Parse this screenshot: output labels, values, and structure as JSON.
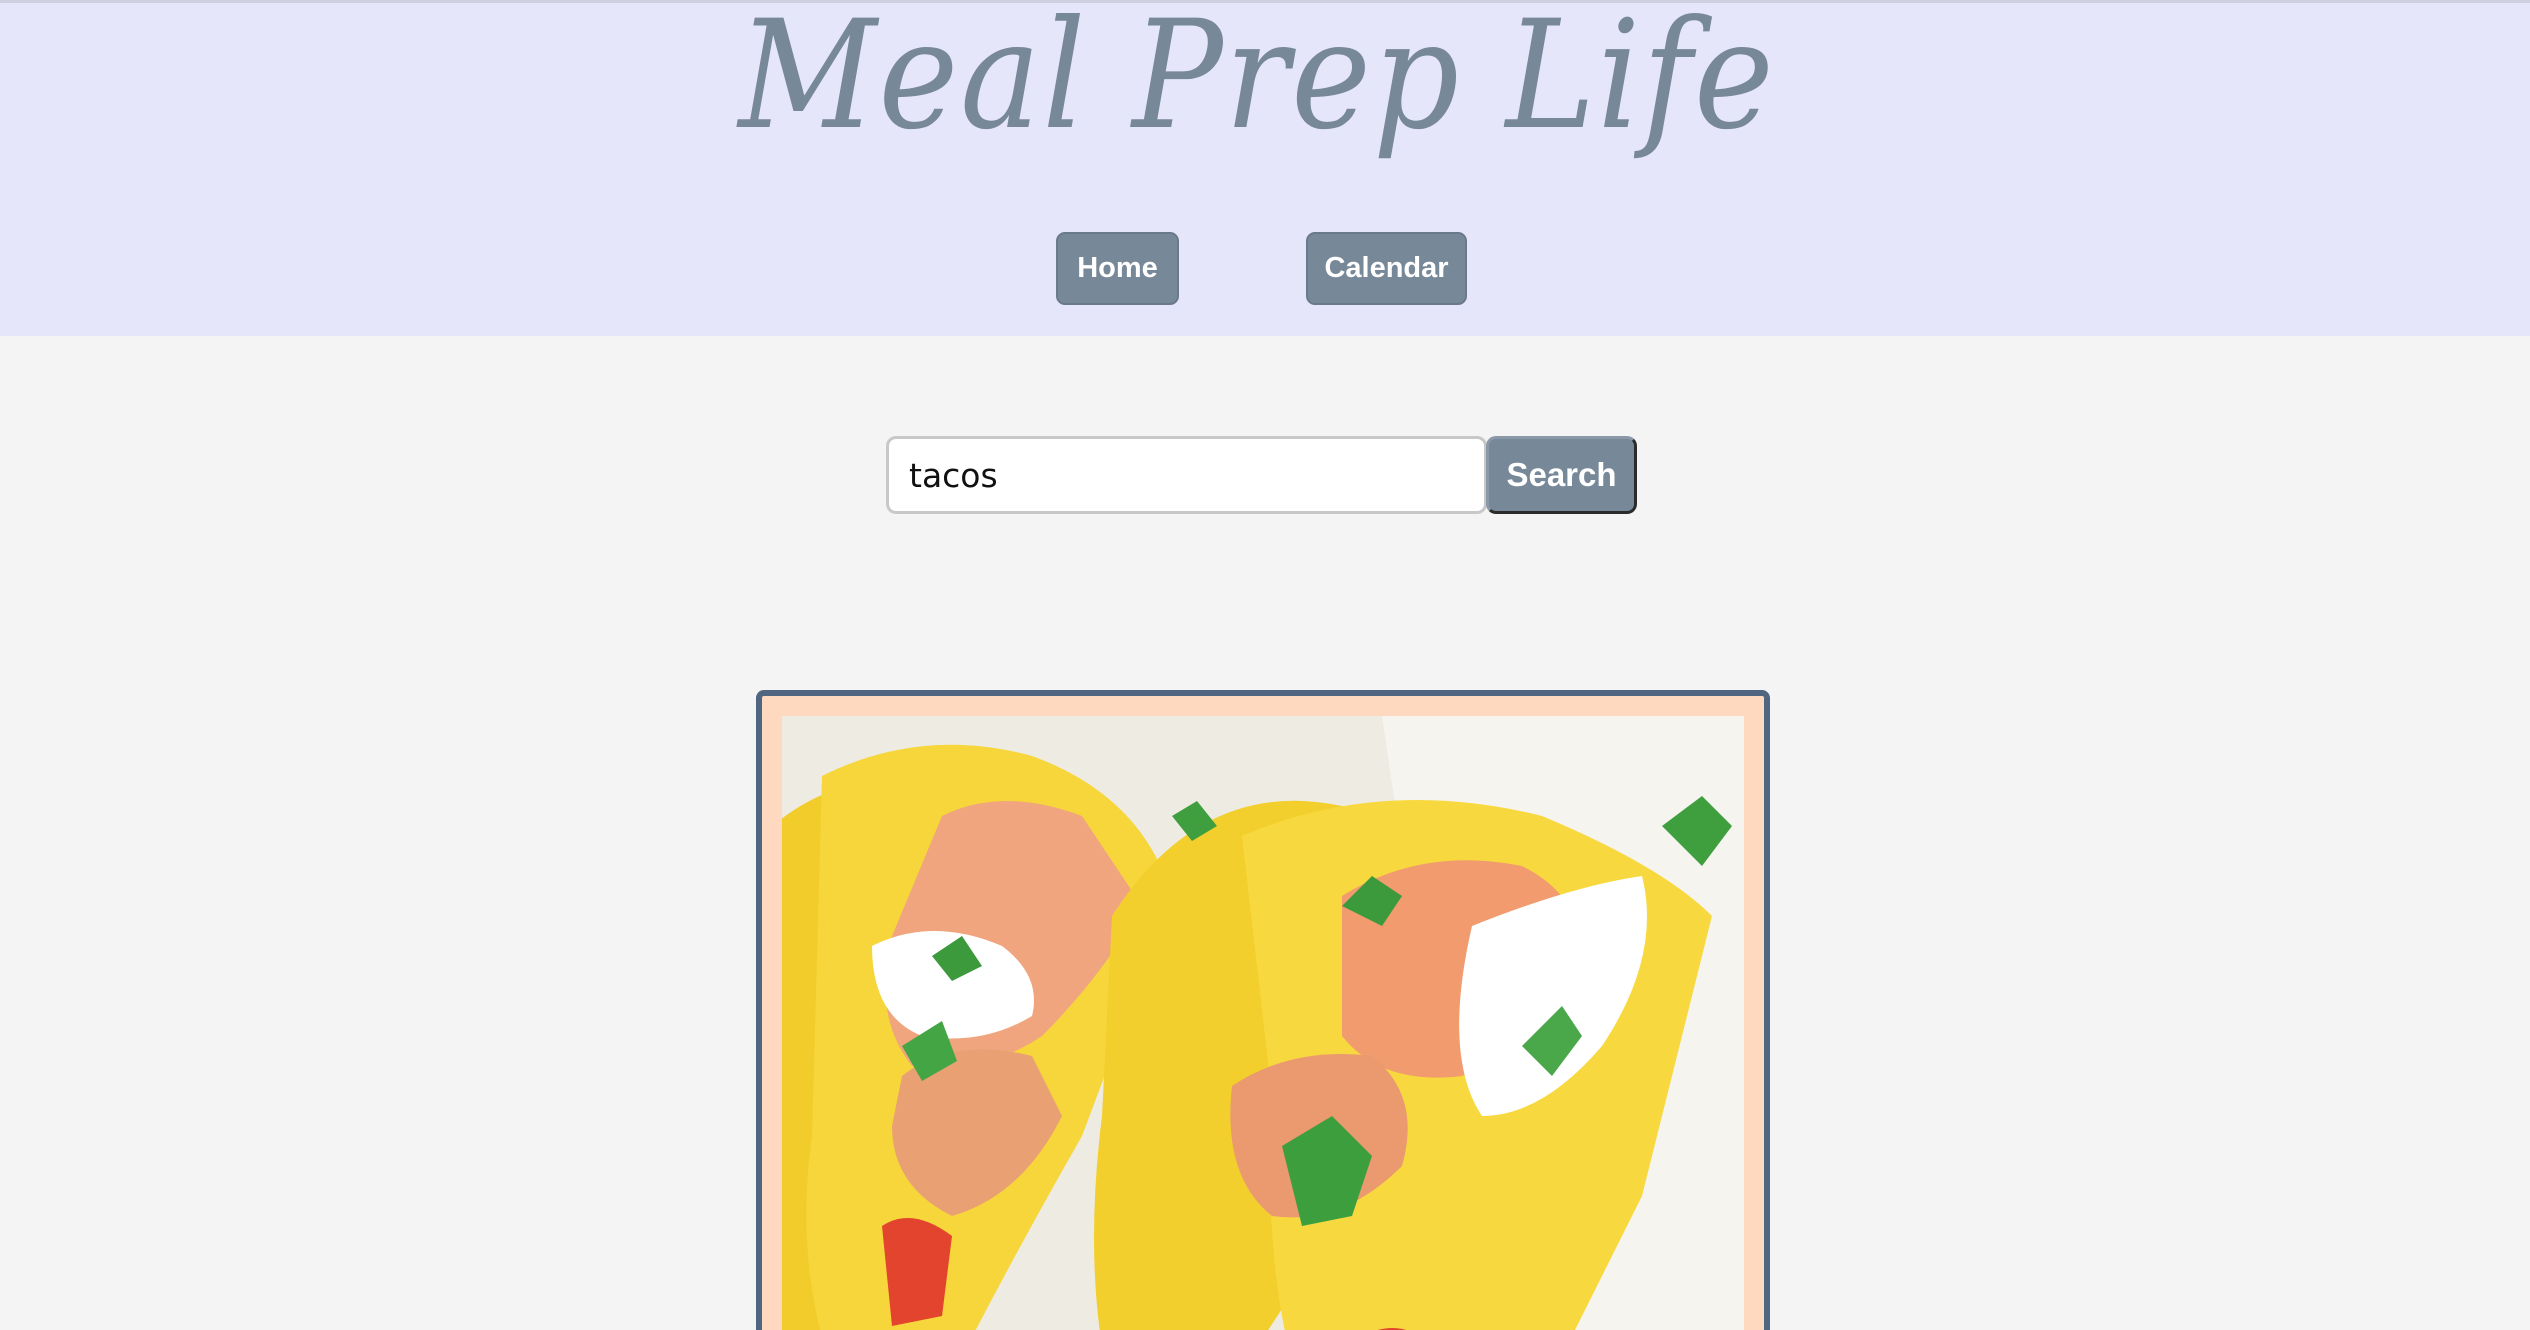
{
  "header": {
    "site_title": "Meal Prep Life",
    "nav": [
      {
        "label": "Home"
      },
      {
        "label": "Calendar"
      }
    ]
  },
  "search": {
    "value": "tacos",
    "button_label": "Search"
  },
  "results": [
    {
      "image": "shrimp-tacos-photo"
    }
  ],
  "colors": {
    "header_bg": "#e6e6fa",
    "accent": "#778899",
    "page_bg": "#f4f4f4",
    "card_bg": "#ffd9bf",
    "card_border": "#4f6580"
  }
}
